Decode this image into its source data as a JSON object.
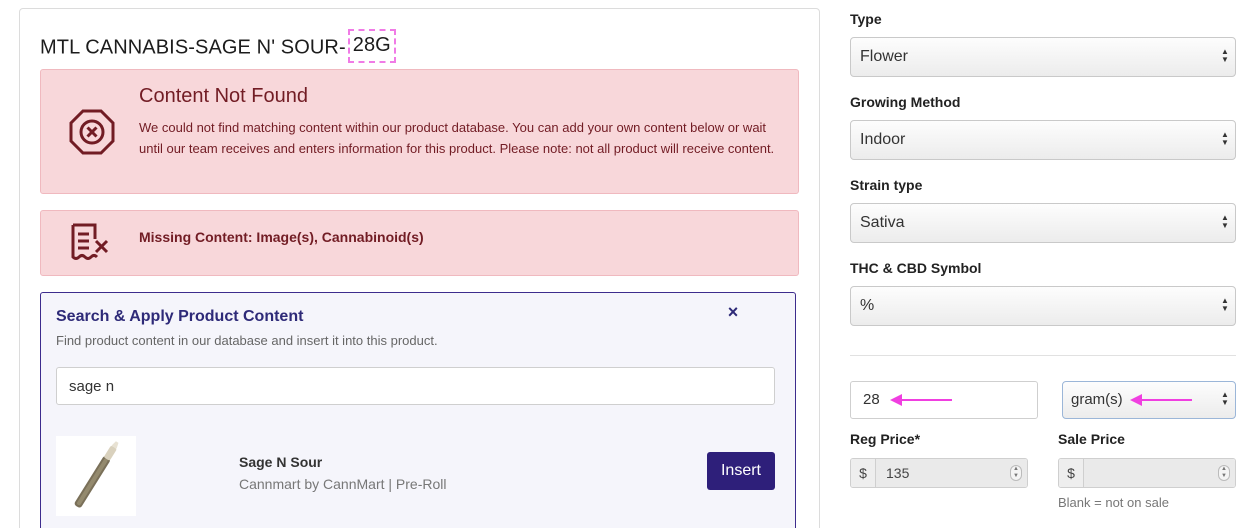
{
  "product": {
    "title_prefix": "MTL CANNABIS-SAGE N' SOUR-",
    "title_highlight": "28G"
  },
  "alerts": {
    "not_found": {
      "heading": "Content Not Found",
      "body": "We could not find matching content within our product database. You can add your own content below or wait until our team receives and enters information for this product. Please note: not all product will receive content.",
      "icon": "octagon-x-icon"
    },
    "missing": {
      "text": "Missing Content: Image(s), Cannabinoid(s)",
      "icon": "document-x-icon"
    }
  },
  "search_panel": {
    "title": "Search & Apply Product Content",
    "subtitle": "Find product content in our database and insert it into this product.",
    "close_glyph": "×",
    "query": "sage n",
    "result": {
      "name": "Sage N Sour",
      "meta": "Cannmart by CannMart | Pre-Roll",
      "insert_label": "Insert"
    }
  },
  "fields": {
    "type": {
      "label": "Type",
      "value": "Flower"
    },
    "growing_method": {
      "label": "Growing Method",
      "value": "Indoor"
    },
    "strain_type": {
      "label": "Strain type",
      "value": "Sativa"
    },
    "thc_cbd_symbol": {
      "label": "THC & CBD Symbol",
      "value": "%"
    },
    "quantity": {
      "value": "28"
    },
    "unit": {
      "value": "gram(s)"
    },
    "reg_price": {
      "label": "Reg Price*",
      "currency": "$",
      "value": "135"
    },
    "sale_price": {
      "label": "Sale Price",
      "currency": "$",
      "value": "",
      "note": "Blank = not on sale"
    }
  },
  "colors": {
    "alert_bg": "#f8d7da",
    "alert_text": "#721c24",
    "accent": "#2e1f7a",
    "annotation": "#f07be6"
  }
}
